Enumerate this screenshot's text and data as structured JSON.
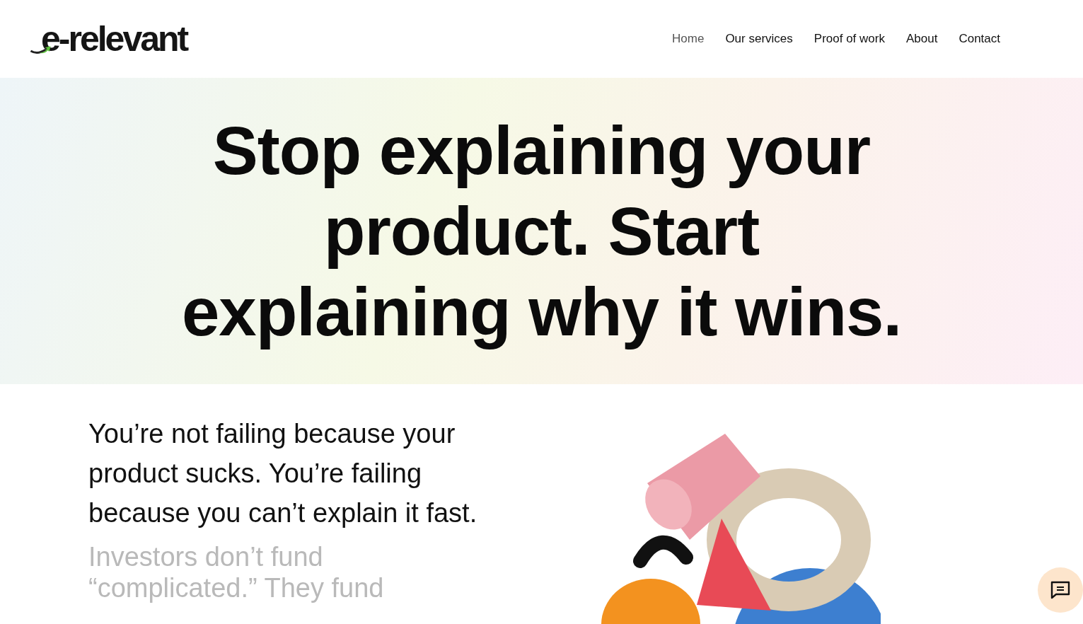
{
  "header": {
    "logo": "e-relevant",
    "nav": [
      {
        "label": "Home",
        "selected": true
      },
      {
        "label": "Our services",
        "selected": false
      },
      {
        "label": "Proof of work",
        "selected": false
      },
      {
        "label": "About",
        "selected": false
      },
      {
        "label": "Contact",
        "selected": false
      }
    ]
  },
  "hero": {
    "headline": "Stop explaining your product. Start explaining why it wins."
  },
  "intro": {
    "lead": "You’re not failing because your product sucks. You’re failing because you can’t explain it fast.",
    "secondary": "Investors don’t fund “complicated.” They fund"
  }
}
